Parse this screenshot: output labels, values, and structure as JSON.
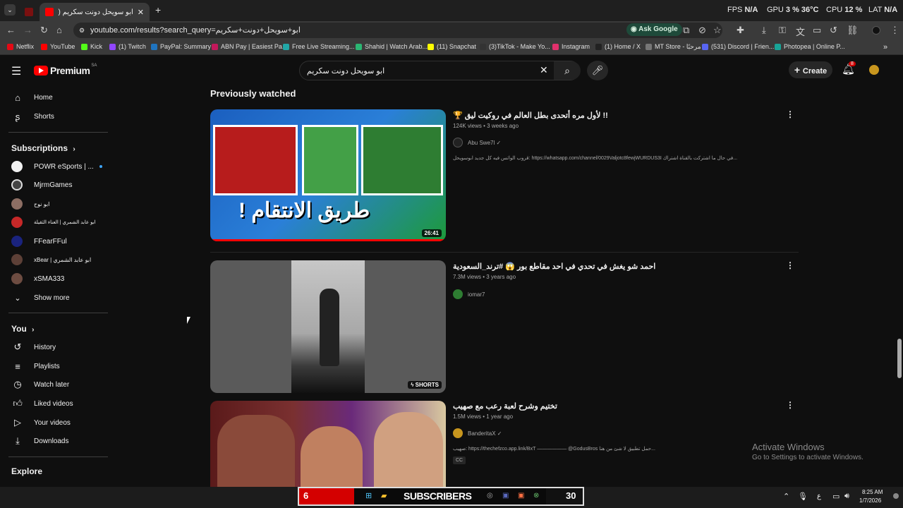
{
  "browser": {
    "tab_title": "ابو سويحل دونت سكريم (8) - YouTube",
    "new_tab_symbol": "+",
    "url": "youtube.com/results?search_query=ابو+سويحل+دونت+سكريم",
    "ask_google": "Ask Google",
    "stats": [
      {
        "label": "FPS",
        "value": "N/A"
      },
      {
        "label": "GPU",
        "value": "3 %  36°C"
      },
      {
        "label": "CPU",
        "value": "12 %"
      },
      {
        "label": "LAT",
        "value": "N/A"
      }
    ],
    "bookmarks": [
      {
        "label": "Netflix",
        "color": "#e50914"
      },
      {
        "label": "YouTube",
        "color": "#ff0000"
      },
      {
        "label": "Kick",
        "color": "#53fc18"
      },
      {
        "label": "(1) Twitch",
        "color": "#9146ff"
      },
      {
        "label": "PayPal: Summary",
        "color": "#1f74bf"
      },
      {
        "label": "ABN Pay | Easiest Pa...",
        "color": "#c2185b"
      },
      {
        "label": "Free Live Streaming...",
        "color": "#22a7a7"
      },
      {
        "label": "Shahid | Watch Arab...",
        "color": "#2bb673"
      },
      {
        "label": "(11) Snapchat",
        "color": "#fffc00"
      },
      {
        "label": "(3)TikTok - Make Yo...",
        "color": "#333333"
      },
      {
        "label": "Instagram",
        "color": "#e1306c"
      },
      {
        "label": "(1) Home / X",
        "color": "#222222"
      },
      {
        "label": "MT Store - مرحبًا",
        "color": "#777777"
      },
      {
        "label": "(531) Discord | Frien...",
        "color": "#5865f2"
      },
      {
        "label": "Photopea | Online P...",
        "color": "#18a497"
      }
    ]
  },
  "yt": {
    "logo": "Premium",
    "region": "SA",
    "search_value": "ابو سويحل دونت سكريم",
    "create": "Create",
    "notif_count": "8"
  },
  "sidebar": {
    "home": "Home",
    "shorts": "Shorts",
    "subscriptions": "Subscriptions",
    "subs": [
      {
        "label": "POWR eSports | ...",
        "color": "#f1f1f1"
      },
      {
        "label": "MjrmGames",
        "color": "#444444"
      },
      {
        "label": "ابو نوح",
        "color": "#8d6e63"
      },
      {
        "label": "ابو عابد الشمري | العناء الثقيلة",
        "color": "#c62828"
      },
      {
        "label": "FFearFFul",
        "color": "#1a237e"
      },
      {
        "label": "xBear | ابو عابد الشمري",
        "color": "#5d4037"
      },
      {
        "label": "xSMA333",
        "color": "#6d4c41"
      }
    ],
    "show_more": "Show more",
    "you": "You",
    "you_items": [
      "History",
      "Playlists",
      "Watch later",
      "Liked videos",
      "Your videos",
      "Downloads"
    ],
    "explore": "Explore"
  },
  "results": {
    "section_title": "Previously watched",
    "videos": [
      {
        "title": "!! لأول مره أتحدى بطل العالم في روكيت ليق 🏆",
        "meta": "124K views • 3 weeks ago",
        "channel": "Abu Swe7l ✓",
        "description": "...في حال ما اشتركت بالقناة اشتراك https://whatsapp.com/channel/0029Valjotc8fewjWURDUS3I :قروب الواتس فيه كل جديد ابوسويحل",
        "duration": "26:41",
        "thumb_text": "طريق الانتقام !"
      },
      {
        "title": "احمد شو يغش في تحدي في احد مقاطع بور 😱 #ترند_السعودية",
        "meta": "7.3M views • 3 years ago",
        "channel": "iomar7",
        "badge": "SHORTS"
      },
      {
        "title": "تختيم وشرح لعبة رعب مع صهيب",
        "meta": "1.5M views • 1 year ago",
        "channel": "BanderitaX ✓",
        "description": "...حمل تطبيق لا شئ من هنا https://thechefzco.app.link/BxT —————— @GodusBros :صهيب",
        "cc": "CC"
      }
    ]
  },
  "watermark": {
    "line1": "Activate Windows",
    "line2": "Go to Settings to activate Windows."
  },
  "taskbar": {
    "overlay_left": "6",
    "overlay_text": "SUBSCRIBERS",
    "overlay_right": "30",
    "lang": "ع",
    "time": "8:25 AM",
    "date": "1/7/2026"
  }
}
